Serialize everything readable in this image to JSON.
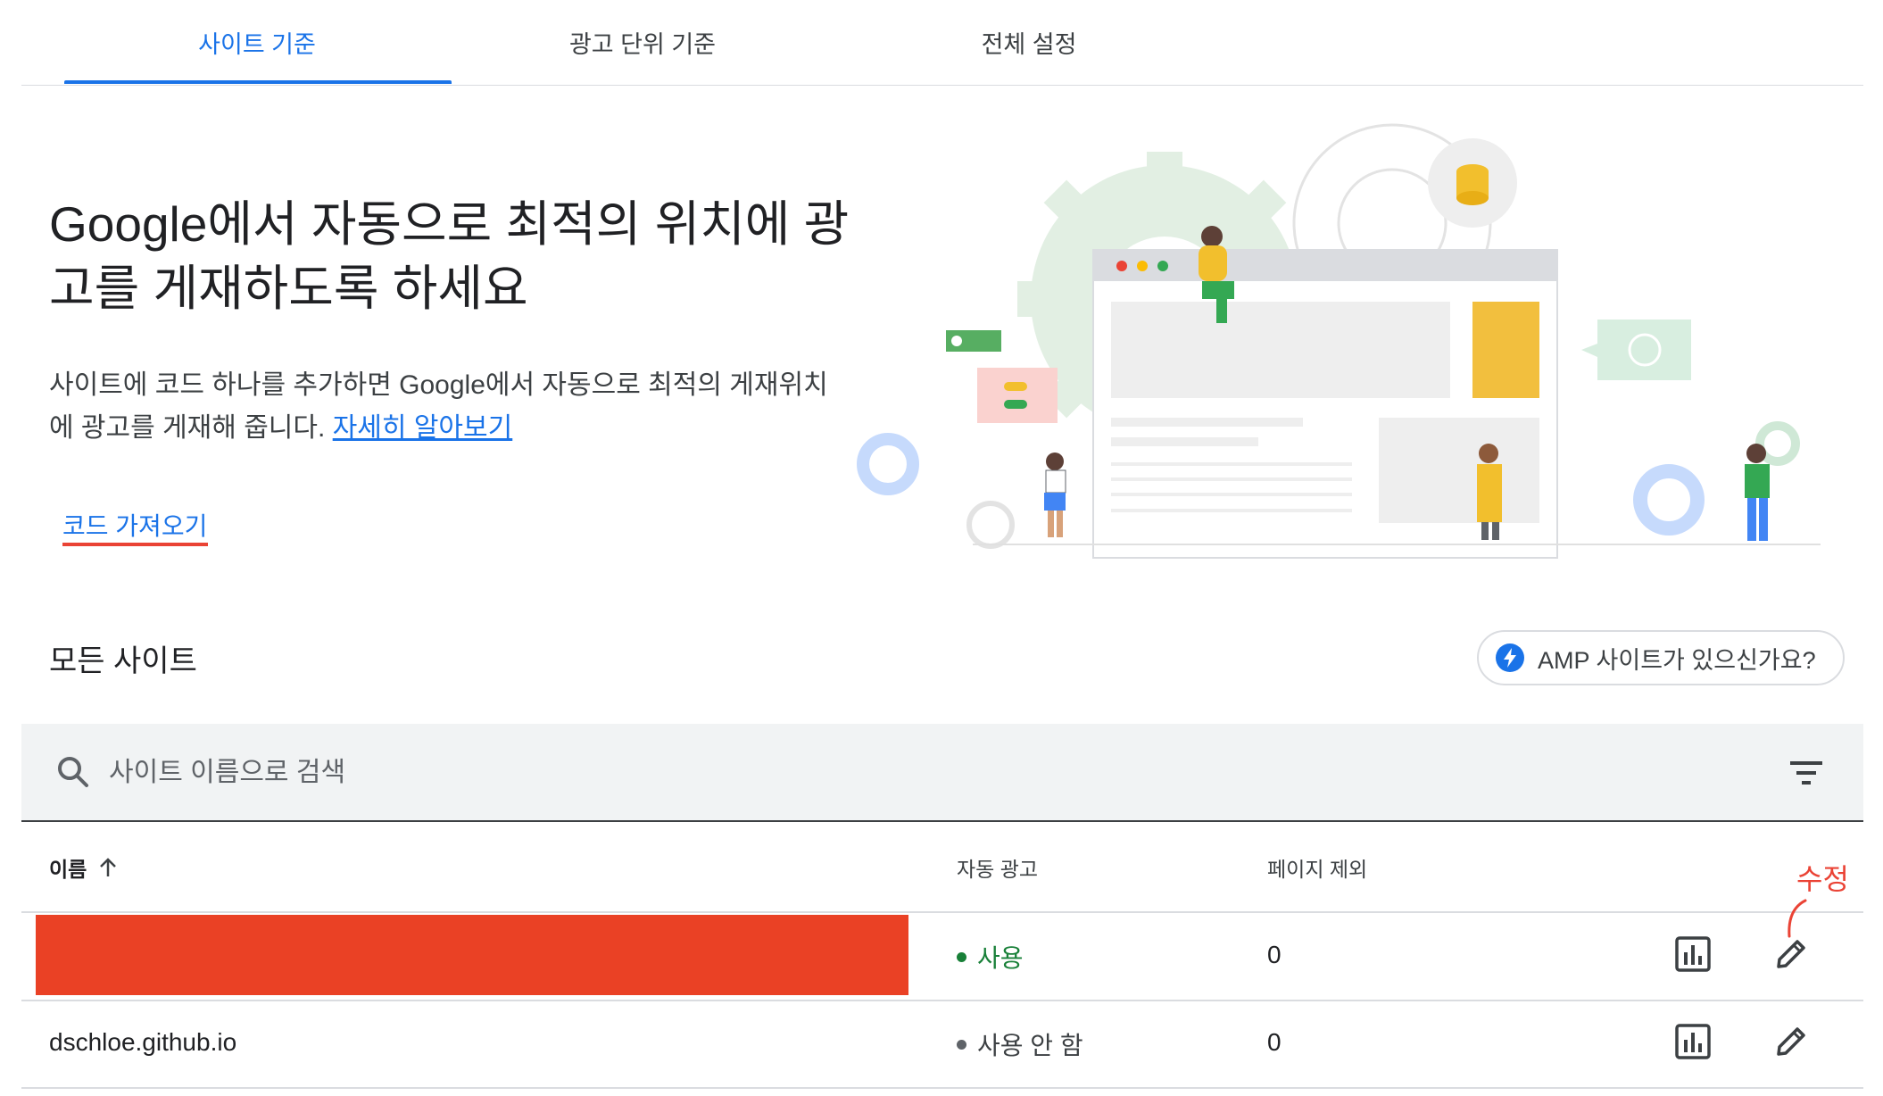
{
  "tabs": [
    {
      "label": "사이트 기준",
      "active": true
    },
    {
      "label": "광고 단위 기준",
      "active": false
    },
    {
      "label": "전체 설정",
      "active": false
    }
  ],
  "hero": {
    "title": "Google에서 자동으로 최적의 위치에 광고를 게재하도록 하세요",
    "description": "사이트에 코드 하나를 추가하면 Google에서 자동으로 최적의 게재위치에 광고를 게재해 줍니다.",
    "learn_more": "자세히 알아보기",
    "get_code": "코드 가져오기"
  },
  "sites": {
    "title": "모든 사이트",
    "amp_button": "AMP 사이트가 있으신가요?",
    "search_placeholder": "사이트 이름으로 검색",
    "columns": {
      "name": "이름",
      "auto_ads": "자동 광고",
      "page_exclusions": "페이지 제외"
    },
    "rows": [
      {
        "name": "",
        "status": "사용",
        "exclusions": "0"
      },
      {
        "name": "dschloe.github.io",
        "status": "사용 안 함",
        "exclusions": "0"
      }
    ]
  },
  "annotation": {
    "label": "수정",
    "color": "#ea4335"
  },
  "colors": {
    "accent": "#1a73e8",
    "status_on": "#188038",
    "redaction": "#ea4125"
  }
}
